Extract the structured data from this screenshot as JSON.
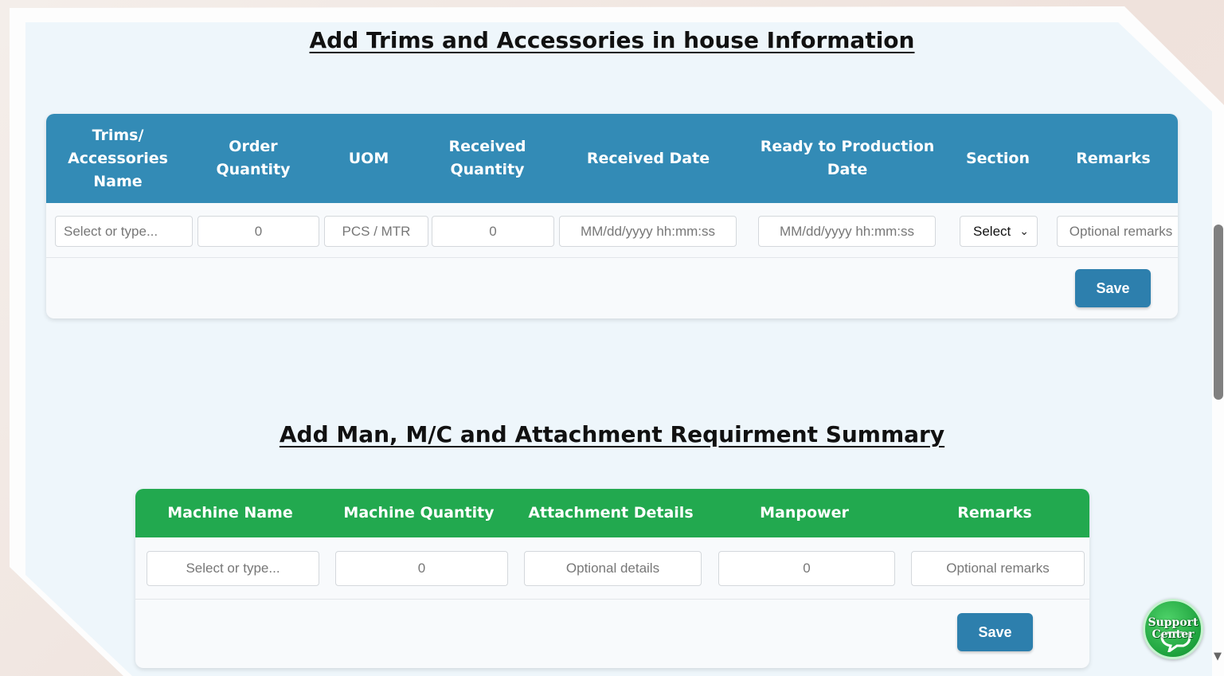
{
  "trims_section": {
    "title": "Add Trims and Accessories in house Information",
    "header_color": "#338bb6",
    "headers": [
      "Trims/ Accessories Name",
      "Order Quantity",
      "UOM",
      "Received Quantity",
      "Received Date",
      "Ready to Production Date",
      "Section",
      "Remarks"
    ],
    "fields": {
      "name_placeholder": "Select or type...",
      "order_qty_value": "0",
      "uom_placeholder": "PCS / MTR",
      "received_qty_value": "0",
      "received_date_placeholder": "MM/dd/yyyy hh:mm:ss",
      "ready_date_placeholder": "MM/dd/yyyy hh:mm:ss",
      "section_selected": "Select",
      "remarks_placeholder": "Optional remarks"
    },
    "save_label": "Save"
  },
  "machine_section": {
    "title": "Add Man, M/C and Attachment Requirment Summary",
    "header_color": "#22a94f",
    "headers": [
      "Machine Name",
      "Machine Quantity",
      "Attachment Details",
      "Manpower",
      "Remarks"
    ],
    "fields": {
      "machine_name_placeholder": "Select or type...",
      "machine_qty_value": "0",
      "attachment_placeholder": "Optional details",
      "manpower_value": "0",
      "remarks_placeholder": "Optional remarks"
    },
    "save_label": "Save"
  },
  "support_widget": {
    "line1": "Support",
    "line2": "Center"
  },
  "button_color": "#2d7fad"
}
